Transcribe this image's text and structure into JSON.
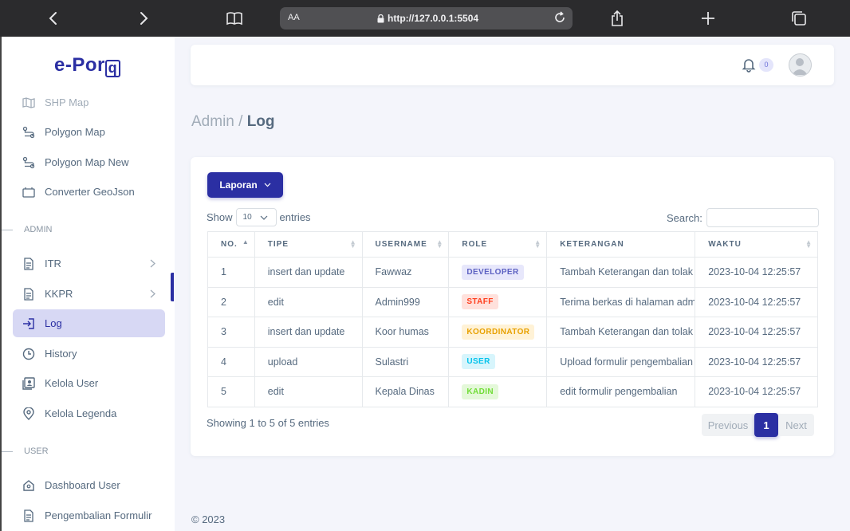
{
  "browser": {
    "text_size": "AA",
    "url": "http://127.0.0.1:5504"
  },
  "brand": {
    "text": "e-Por",
    "boxed": "q"
  },
  "sidebar": {
    "items_top": [
      {
        "label": "SHP Map",
        "icon": "map-icon"
      },
      {
        "label": "Polygon Map",
        "icon": "route-icon"
      },
      {
        "label": "Polygon Map New",
        "icon": "route-icon"
      },
      {
        "label": "Converter GeoJson",
        "icon": "converter-icon"
      }
    ],
    "section_admin": "ADMIN",
    "items_admin": [
      {
        "label": "ITR",
        "icon": "file-icon"
      },
      {
        "label": "KKPR",
        "icon": "file-icon"
      },
      {
        "label": "Log",
        "icon": "login-icon"
      },
      {
        "label": "History",
        "icon": "clock-icon"
      },
      {
        "label": "Kelola User",
        "icon": "user-card-icon"
      },
      {
        "label": "Kelola Legenda",
        "icon": "map-pin-icon"
      }
    ],
    "section_user": "USER",
    "items_user": [
      {
        "label": "Dashboard User",
        "icon": "home-icon"
      },
      {
        "label": "Pengembalian Formulir",
        "icon": "file-icon"
      }
    ]
  },
  "navbar": {
    "notification_count": "0"
  },
  "breadcrumb": {
    "parent": "Admin /",
    "current": "Log"
  },
  "card": {
    "report_button": "Laporan",
    "show_label": "Show",
    "show_value": "10",
    "entries_label": "entries",
    "search_label": "Search:",
    "table": {
      "headers": [
        "NO.",
        "TIPE",
        "USERNAME",
        "ROLE",
        "KETERANGAN",
        "WAKTU"
      ],
      "rows": [
        {
          "no": "1",
          "tipe": "insert dan update",
          "username": "Fawwaz",
          "role": "DEVELOPER",
          "keterangan": "Tambah Keterangan dan tolak",
          "waktu": "2023-10-04 12:25:57"
        },
        {
          "no": "2",
          "tipe": "edit",
          "username": "Admin999",
          "role": "STAFF",
          "keterangan": "Terima berkas di halaman adm",
          "waktu": "2023-10-04 12:25:57"
        },
        {
          "no": "3",
          "tipe": "insert dan update",
          "username": "Koor humas",
          "role": "KOORDINATOR",
          "keterangan": "Tambah Keterangan dan tolak",
          "waktu": "2023-10-04 12:25:57"
        },
        {
          "no": "4",
          "tipe": "upload",
          "username": "Sulastri",
          "role": "USER",
          "keterangan": "Upload formulir pengembalian",
          "waktu": "2023-10-04 12:25:57"
        },
        {
          "no": "5",
          "tipe": "edit",
          "username": "Kepala Dinas",
          "role": "KADIN",
          "keterangan": "edit formulir pengembalian",
          "waktu": "2023-10-04 12:25:57"
        }
      ]
    },
    "showing": "Showing 1 to 5 of 5 entries",
    "pagination": {
      "previous": "Previous",
      "current": "1",
      "next": "Next"
    }
  },
  "footer": {
    "copyright": "© 2023"
  },
  "colors": {
    "primary": "#2b2fa3",
    "browser_bar": "#2b2b2d",
    "background": "#f4f5fb"
  }
}
